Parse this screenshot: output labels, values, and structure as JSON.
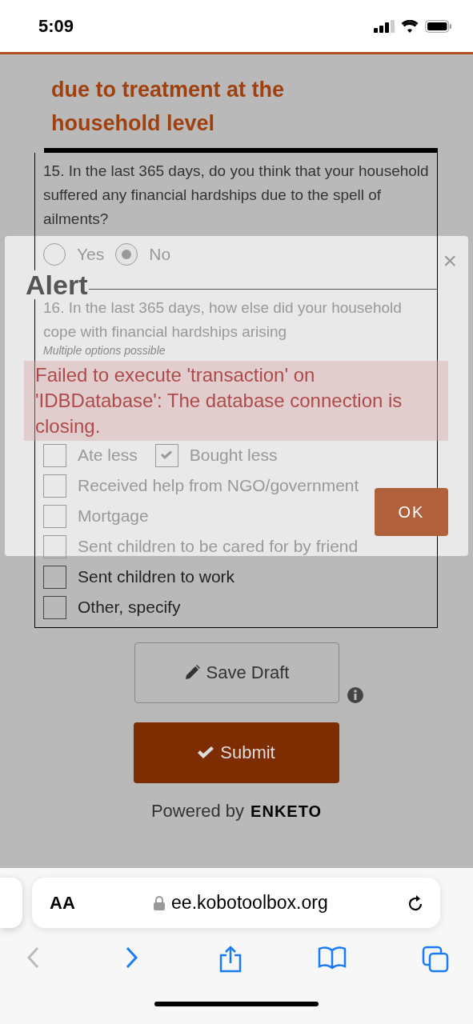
{
  "status_bar": {
    "time": "5:09"
  },
  "section": {
    "title": "due to treatment at the household level"
  },
  "questions": [
    {
      "kind": "radio",
      "label": "15. In the last 365 days, do you think that your household suffered any financial hardships due to the spell of ailments?",
      "options": [
        {
          "label": "Yes",
          "selected": false
        },
        {
          "label": "No",
          "selected": true
        }
      ]
    },
    {
      "kind": "checkbox",
      "label": "16. In the last 365 days, how else did your household cope with financial hardships arising",
      "hint": "Multiple options possible",
      "options": [
        {
          "label": "Ate less",
          "checked": false
        },
        {
          "label": "Bought less",
          "checked": true
        },
        {
          "label": "Received help from NGO/government",
          "checked": false
        },
        {
          "label": "Mortgage",
          "checked": false
        },
        {
          "label": "Sent children to be cared for by friend",
          "checked": false
        },
        {
          "label": "Sent children to work",
          "checked": false
        },
        {
          "label": "Other, specify",
          "checked": false
        }
      ]
    }
  ],
  "actions": {
    "save_draft": "Save Draft",
    "submit": "Submit"
  },
  "footer": {
    "powered_by": "Powered by",
    "brand": "ENKETO"
  },
  "alert": {
    "title": "Alert",
    "close": "×",
    "message": "Failed to execute 'transaction' on 'IDBDatabase': The database connection is closing.",
    "ok": "OK"
  },
  "browser": {
    "text_size": "AA",
    "url": "ee.kobotoolbox.org",
    "back_enabled": false,
    "forward_enabled": true
  }
}
